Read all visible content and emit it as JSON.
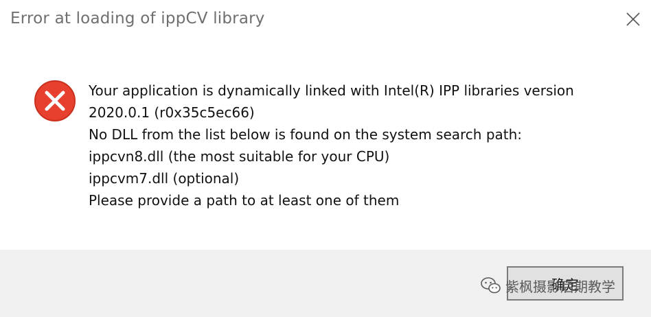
{
  "window": {
    "title": "Error at loading of ippCV library"
  },
  "icons": {
    "close": "close-icon",
    "error": "error-icon",
    "watermark": "wechat-icon"
  },
  "message": {
    "lines": [
      "Your application is dynamically linked with Intel(R) IPP libraries version",
      "2020.0.1 (r0x35c5ec66)",
      "No DLL from the list below is found on the system search path:",
      "ippcvn8.dll (the most suitable for your CPU)",
      "ippcvm7.dll (optional)",
      "Please provide a path to at least one of them"
    ]
  },
  "footer": {
    "ok_label": "确定"
  },
  "watermark": {
    "text": "紫枫摄影后期教学"
  },
  "colors": {
    "error_red": "#e8402f",
    "footer_bg": "#f0f0f0",
    "button_bg": "#e1e1e1",
    "button_border": "#7a7a7a"
  }
}
